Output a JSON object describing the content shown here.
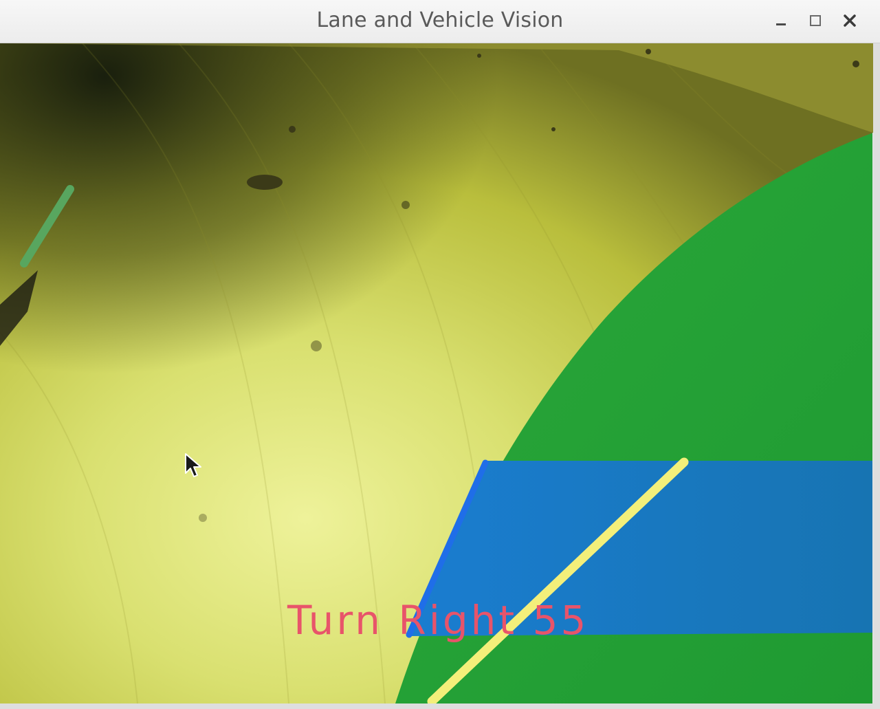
{
  "window": {
    "title": "Lane and Vehicle Vision",
    "controls": {
      "minimize_icon": "minimize-icon",
      "maximize_icon": "maximize-icon",
      "close_icon": "close-icon"
    }
  },
  "overlay": {
    "steering_text": "Turn Right 55",
    "steering_color": "#e8546a",
    "detected_lane_line_color": "#f3ef7a",
    "boundary_line_color": "#1f6ee8",
    "lane_area_color": "#1a82c4",
    "drivable_region_color": "#26a83a"
  }
}
